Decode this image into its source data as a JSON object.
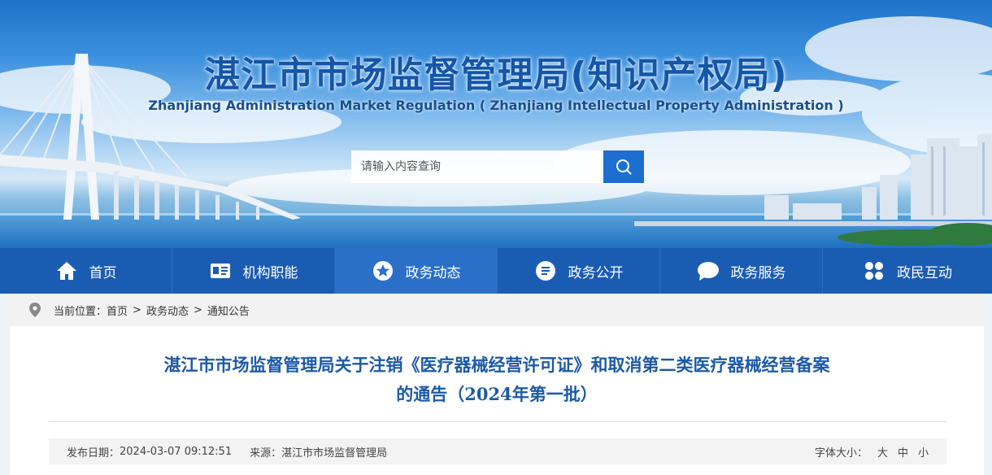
{
  "header": {
    "title": "湛江市市场监督管理局(知识产权局)",
    "subtitle": "Zhanjiang Administration Market Regulation ( Zhanjiang Intellectual Property Administration )"
  },
  "search": {
    "placeholder": "请输入内容查询",
    "icon": "search-icon"
  },
  "nav": {
    "items": [
      {
        "label": "首页",
        "icon": "home-icon"
      },
      {
        "label": "机构职能",
        "icon": "id-card-icon"
      },
      {
        "label": "政务动态",
        "icon": "star-badge-icon"
      },
      {
        "label": "政务公开",
        "icon": "list-circle-icon"
      },
      {
        "label": "政务服务",
        "icon": "chat-bubble-icon"
      },
      {
        "label": "政民互动",
        "icon": "grid-petals-icon"
      }
    ],
    "active_index": 2,
    "colors": {
      "bar": "#1b5cb3",
      "active": "#2b70c8"
    }
  },
  "breadcrumb": {
    "prefix": "当前位置：",
    "items": [
      "首页",
      "政务动态",
      "通知公告"
    ],
    "separator": ">"
  },
  "article": {
    "title_line1": "湛江市市场监督管理局关于注销《医疗器械经营许可证》和取消第二类医疗器械经营备案",
    "title_line2": "的通告（2024年第一批）",
    "publish_label": "发布日期：",
    "publish_date": "2024-03-07 09:12:51",
    "source_label": "来源：",
    "source": "湛江市市场监督管理局",
    "font_size_label": "字体大小：",
    "font_sizes": [
      "大",
      "中",
      "小"
    ]
  }
}
